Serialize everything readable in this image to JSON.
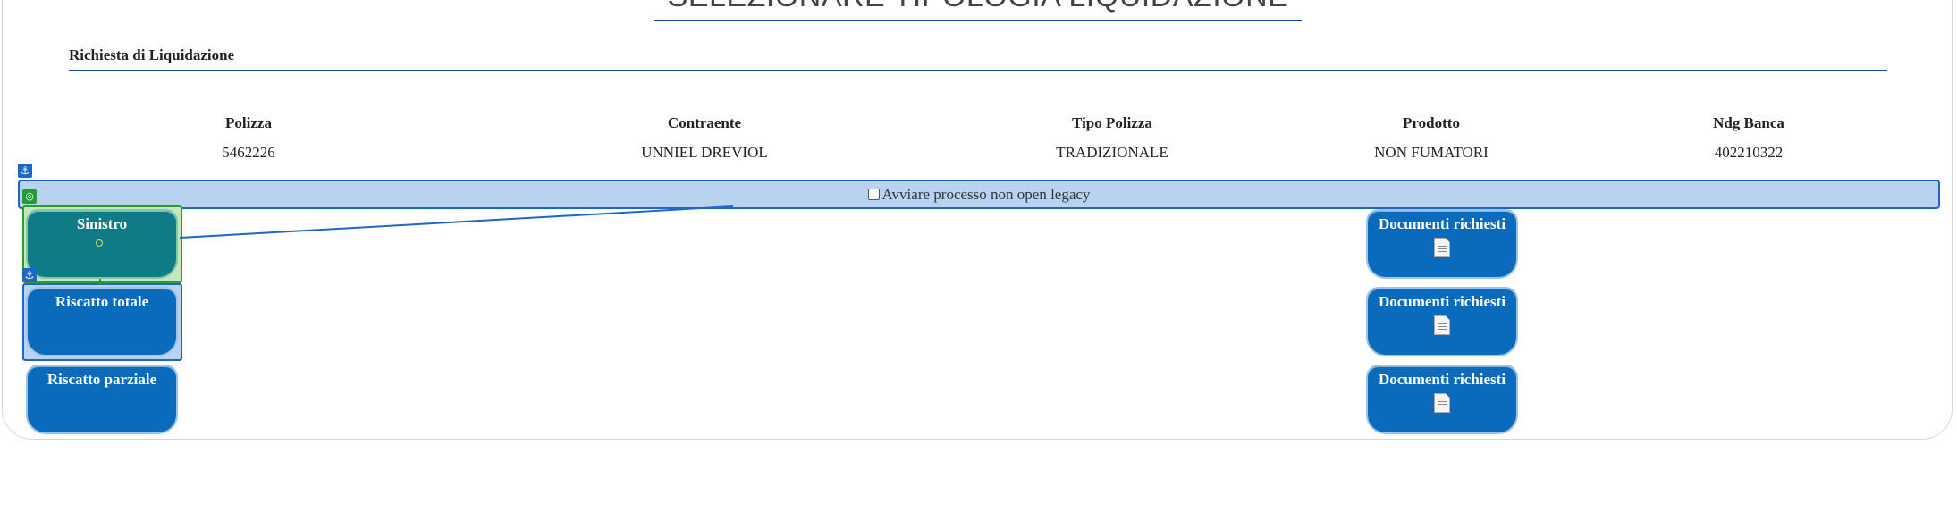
{
  "page": {
    "title": "SELEZIONARE TIPOLOGIA LIQUIDAZIONE",
    "section_title": "Richiesta di Liquidazione"
  },
  "policy_table": {
    "columns": [
      {
        "header": "Polizza",
        "value": "5462226"
      },
      {
        "header": "Contraente",
        "value": "UNNIEL DREVIOL"
      },
      {
        "header": "Tipo Polizza",
        "value": "TRADIZIONALE"
      },
      {
        "header": "Prodotto",
        "value": "NON FUMATORI"
      },
      {
        "header": "Ndg Banca",
        "value": "402210322"
      }
    ]
  },
  "legacy_option": {
    "label": "Avviare processo non open legacy",
    "checked": false
  },
  "liquidation_types": [
    {
      "label": "Sinistro",
      "selected": true
    },
    {
      "label": "Riscatto totale",
      "selected": false
    },
    {
      "label": "Riscatto parziale",
      "selected": false
    }
  ],
  "documents": [
    {
      "label": "Documenti richiesti",
      "icon": "document-icon"
    },
    {
      "label": "Documenti richiesti",
      "icon": "document-icon"
    },
    {
      "label": "Documenti richiesti",
      "icon": "document-icon"
    }
  ],
  "colors": {
    "accent": "#0b4aa0",
    "card_blue": "#0a6bbd",
    "card_teal": "#0e7b86",
    "highlight_blue": "#b9d2ef",
    "highlight_green": "#c4e7bf"
  }
}
